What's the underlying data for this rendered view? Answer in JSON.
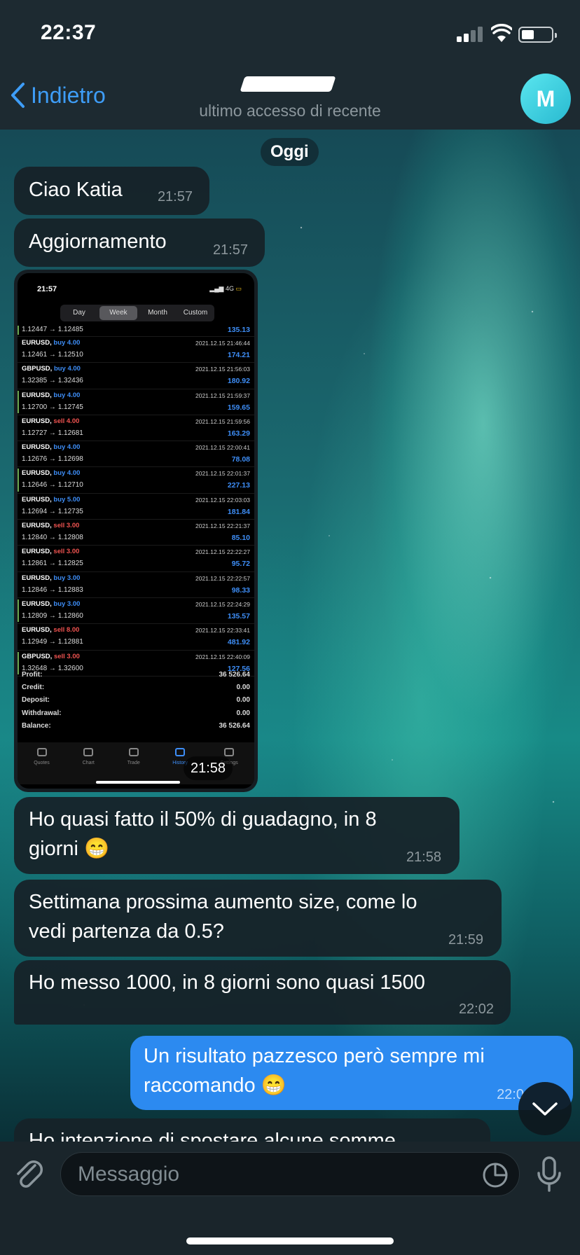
{
  "status_bar": {
    "time": "22:37"
  },
  "header": {
    "back_label": "Indietro",
    "last_seen": "ultimo accesso di recente",
    "avatar_letter": "M"
  },
  "chat": {
    "date_label": "Oggi",
    "messages": [
      {
        "text": "Ciao Katia",
        "time": "21:57",
        "direction": "in"
      },
      {
        "text": "Aggiornamento",
        "time": "21:57",
        "direction": "in"
      },
      {
        "type": "image",
        "time": "21:58",
        "direction": "in"
      },
      {
        "text": "Ho quasi fatto il 50% di guadagno, in 8 giorni 😁",
        "time": "21:58",
        "direction": "in"
      },
      {
        "text": "Settimana prossima aumento size, come lo vedi partenza da 0.5?",
        "time": "21:59",
        "direction": "in"
      },
      {
        "text": "Ho messo 1000, in 8 giorni sono quasi 1500",
        "time": "22:02",
        "direction": "in"
      },
      {
        "text": "Un risultato pazzesco però sempre mi raccomando 😁",
        "time": "22:0",
        "direction": "out"
      },
      {
        "text": "Ho intenzione di spostare alcune somme",
        "time": "",
        "direction": "in"
      }
    ]
  },
  "screenshot": {
    "status_time": "21:57",
    "status_right": "4G",
    "tabs": [
      "Day",
      "Week",
      "Month",
      "Custom"
    ],
    "active_tab": "Week",
    "first_row": {
      "prices": "1.12447 → 1.12485",
      "profit": "135.13"
    },
    "trades": [
      {
        "symbol": "EURUSD,",
        "dir": "buy 4.00",
        "side": "buy",
        "date": "2021.12.15 21:46:44",
        "prices": "1.12461 → 1.12510",
        "profit": "174.21"
      },
      {
        "symbol": "GBPUSD,",
        "dir": "buy 4.00",
        "side": "buy",
        "date": "2021.12.15 21:56:03",
        "prices": "1.32385 → 1.32436",
        "profit": "180.92"
      },
      {
        "symbol": "EURUSD,",
        "dir": "buy 4.00",
        "side": "buy",
        "date": "2021.12.15 21:59:37",
        "prices": "1.12700 → 1.12745",
        "profit": "159.65"
      },
      {
        "symbol": "EURUSD,",
        "dir": "sell 4.00",
        "side": "sell",
        "date": "2021.12.15 21:59:56",
        "prices": "1.12727 → 1.12681",
        "profit": "163.29"
      },
      {
        "symbol": "EURUSD,",
        "dir": "buy 4.00",
        "side": "buy",
        "date": "2021.12.15 22:00:41",
        "prices": "1.12676 → 1.12698",
        "profit": "78.08"
      },
      {
        "symbol": "EURUSD,",
        "dir": "buy 4.00",
        "side": "buy",
        "date": "2021.12.15 22:01:37",
        "prices": "1.12646 → 1.12710",
        "profit": "227.13"
      },
      {
        "symbol": "EURUSD,",
        "dir": "buy 5.00",
        "side": "buy",
        "date": "2021.12.15 22:03:03",
        "prices": "1.12694 → 1.12735",
        "profit": "181.84"
      },
      {
        "symbol": "EURUSD,",
        "dir": "sell 3.00",
        "side": "sell",
        "date": "2021.12.15 22:21:37",
        "prices": "1.12840 → 1.12808",
        "profit": "85.10"
      },
      {
        "symbol": "EURUSD,",
        "dir": "sell 3.00",
        "side": "sell",
        "date": "2021.12.15 22:22:27",
        "prices": "1.12861 → 1.12825",
        "profit": "95.72"
      },
      {
        "symbol": "EURUSD,",
        "dir": "buy 3.00",
        "side": "buy",
        "date": "2021.12.15 22:22:57",
        "prices": "1.12846 → 1.12883",
        "profit": "98.33"
      },
      {
        "symbol": "EURUSD,",
        "dir": "buy 3.00",
        "side": "buy",
        "date": "2021.12.15 22:24:29",
        "prices": "1.12809 → 1.12860",
        "profit": "135.57"
      },
      {
        "symbol": "EURUSD,",
        "dir": "sell 8.00",
        "side": "sell",
        "date": "2021.12.15 22:33:41",
        "prices": "1.12949 → 1.12881",
        "profit": "481.92"
      },
      {
        "symbol": "GBPUSD,",
        "dir": "sell 3.00",
        "side": "sell",
        "date": "2021.12.15 22:40:09",
        "prices": "1.32648 → 1.32600",
        "profit": "127.56"
      }
    ],
    "summary": [
      {
        "label": "Profit:",
        "value": "36 526.64"
      },
      {
        "label": "Credit:",
        "value": "0.00"
      },
      {
        "label": "Deposit:",
        "value": "0.00"
      },
      {
        "label": "Withdrawal:",
        "value": "0.00"
      },
      {
        "label": "Balance:",
        "value": "36 526.64"
      }
    ],
    "nav": [
      "Quotes",
      "Chart",
      "Trade",
      "History",
      "Settings"
    ],
    "active_nav": "History"
  },
  "input": {
    "placeholder": "Messaggio"
  },
  "icons": {
    "back": "chevron-left-icon",
    "attach": "paperclip-icon",
    "sticker": "sticker-icon",
    "mic": "microphone-icon",
    "scroll": "chevron-down-icon"
  },
  "colors": {
    "accent": "#3e9df7",
    "outgoing_bubble": "#2c8af0",
    "incoming_bubble": "#162228",
    "buy": "#3e8ef7",
    "sell": "#ef5350"
  }
}
